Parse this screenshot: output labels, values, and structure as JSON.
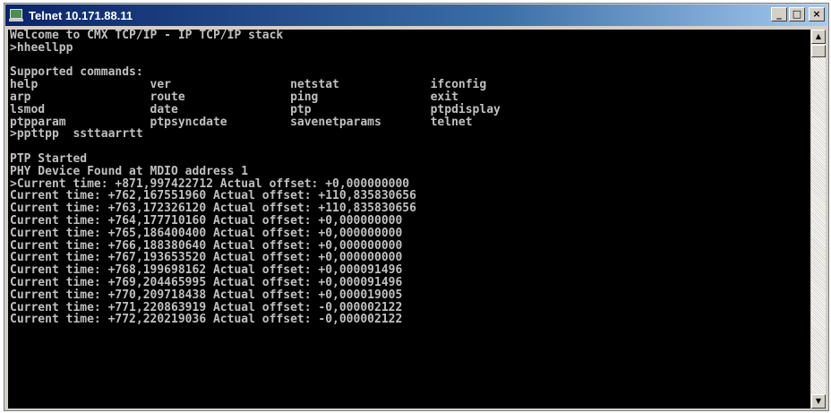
{
  "window": {
    "title": "Telnet 10.171.88.11",
    "icon": "telnet-terminal-icon",
    "controls": {
      "minimize": "_",
      "maximize": "□",
      "close": "×"
    }
  },
  "terminal": {
    "background": "#000000",
    "foreground": "#c0c0c0",
    "lines": [
      "Welcome to CMX TCP/IP - IP TCP/IP stack",
      ">hheellpp",
      "",
      "Supported commands:",
      "help                ver                 netstat             ifconfig",
      "arp                 route               ping                exit",
      "lsmod               date                ptp                 ptpdisplay",
      "ptpparam            ptpsyncdate         savenetparams       telnet",
      ">ppttpp  ssttaarrtt",
      "",
      "PTP Started",
      "PHY Device Found at MDIO address 1",
      ">Current time: +871,997422712 Actual offset: +0,000000000",
      "Current time: +762,167551960 Actual offset: +110,835830656",
      "Current time: +763,172326120 Actual offset: +110,835830656",
      "Current time: +764,177710160 Actual offset: +0,000000000",
      "Current time: +765,186400400 Actual offset: +0,000000000",
      "Current time: +766,188380640 Actual offset: +0,000000000",
      "Current time: +767,193653520 Actual offset: +0,000000000",
      "Current time: +768,199698162 Actual offset: +0,000091496",
      "Current time: +769,204465995 Actual offset: +0,000091496",
      "Current time: +770,209718438 Actual offset: +0,000019005",
      "Current time: +771,220863919 Actual offset: -0,000002122",
      "Current time: +772,220219036 Actual offset: -0,000002122"
    ]
  },
  "scrollbar": {
    "up_arrow": "▲",
    "down_arrow": "▼"
  }
}
